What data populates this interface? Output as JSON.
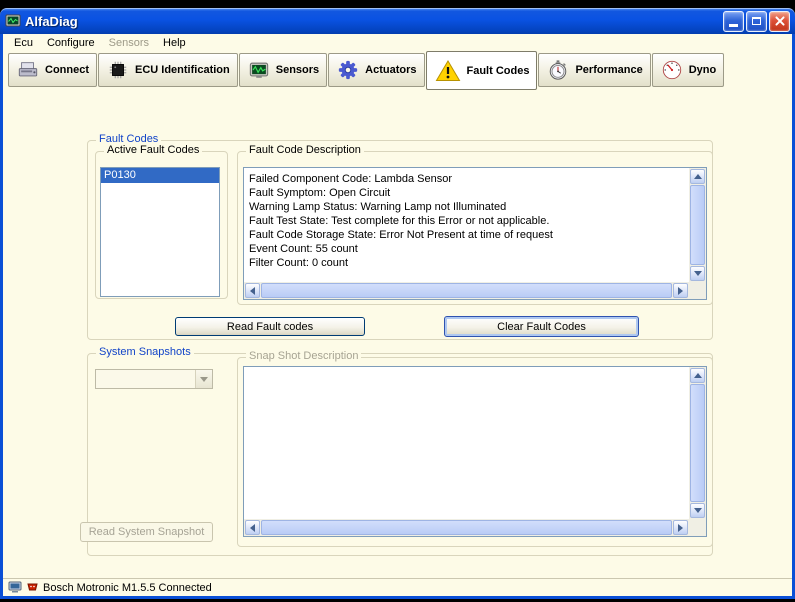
{
  "window": {
    "title": "AlfaDiag"
  },
  "menu": {
    "items": [
      {
        "label": "Ecu",
        "enabled": true
      },
      {
        "label": "Configure",
        "enabled": true
      },
      {
        "label": "Sensors",
        "enabled": false
      },
      {
        "label": "Help",
        "enabled": true
      }
    ]
  },
  "toolbar": {
    "active_tab": "Fault Codes",
    "buttons": [
      {
        "label": "Connect",
        "icon": "device-connect-icon"
      },
      {
        "label": "ECU Identification",
        "icon": "chip-icon"
      },
      {
        "label": "Sensors",
        "icon": "oscilloscope-icon"
      },
      {
        "label": "Actuators",
        "icon": "gear-icon"
      },
      {
        "label": "Fault Codes",
        "icon": "warning-triangle-icon"
      },
      {
        "label": "Performance",
        "icon": "stopwatch-icon"
      },
      {
        "label": "Dyno",
        "icon": "gauge-icon"
      }
    ]
  },
  "fault_codes": {
    "group_label": "Fault Codes",
    "active_list": {
      "label": "Active Fault Codes",
      "items": [
        "P0130"
      ],
      "selected": "P0130"
    },
    "description": {
      "label": "Fault Code Description",
      "lines": [
        "Failed Component Code: Lambda Sensor",
        "Fault Symptom: Open Circuit",
        "Warning Lamp Status: Warning Lamp not Illuminated",
        "Fault Test State: Test complete for this Error or not applicable.",
        "Fault Code Storage State: Error Not Present at time of request",
        "Event Count: 55 count",
        "Filter Count: 0 count"
      ]
    },
    "buttons": {
      "read": "Read Fault codes",
      "clear": "Clear Fault Codes"
    }
  },
  "system_snapshots": {
    "group_label": "System Snapshots",
    "combo": {
      "value": "",
      "enabled": false
    },
    "description": {
      "label": "Snap Shot Description",
      "text": ""
    },
    "buttons": {
      "read": "Read System Snapshot",
      "read_enabled": false
    }
  },
  "statusbar": {
    "text": "Bosch Motronic M1.5.5 Connected"
  },
  "colors": {
    "window_background": "#FDFBE7",
    "titlebar_blue": "#0A52E2",
    "selection_blue": "#316AC5",
    "group_label_blue": "#1244C8",
    "warning_yellow": "#FFD200",
    "close_button_red": "#D8452A"
  }
}
